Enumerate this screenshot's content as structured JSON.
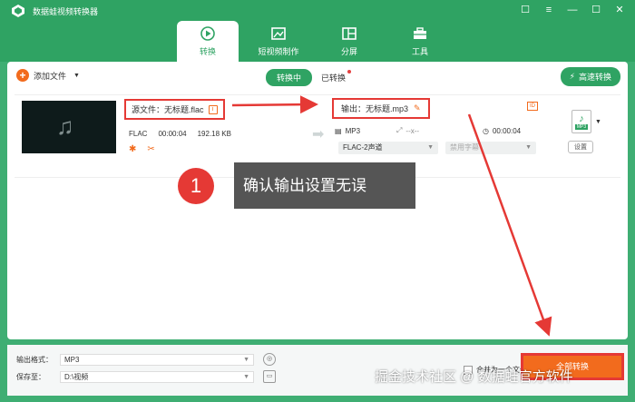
{
  "app": {
    "title": "数据蛙视频转换器"
  },
  "window_controls": [
    "☐",
    "≡",
    "—",
    "☐",
    "✕"
  ],
  "tabs": [
    {
      "label": "转换",
      "icon": "convert-icon",
      "active": true
    },
    {
      "label": "短视频制作",
      "icon": "video-edit-icon",
      "active": false
    },
    {
      "label": "分屏",
      "icon": "split-screen-icon",
      "active": false
    },
    {
      "label": "工具",
      "icon": "toolbox-icon",
      "active": false
    }
  ],
  "toolbar": {
    "add_file": "添加文件",
    "converting": "转换中",
    "converted": "已转换",
    "fast_convert": "高速转换"
  },
  "file": {
    "source_label": "源文件：无标题.flac",
    "src_format": "FLAC",
    "src_duration": "00:00:04",
    "src_size": "192.18 KB",
    "output_label": "输出：无标题.mp3",
    "out_format": "MP3",
    "out_resolution": "--x--",
    "out_duration": "00:00:04",
    "audio_channel": "FLAC-2声道",
    "subtitle": "禁用字幕",
    "format_badge": "MP3",
    "settings": "设置"
  },
  "callout": {
    "number": "1",
    "text": "确认输出设置无误"
  },
  "bottom": {
    "format_label": "输出格式：",
    "format_value": "MP3",
    "save_label": "保存至：",
    "save_value": "D:\\视频",
    "merge_label": "合并为一个文件",
    "convert_all": "全部转换"
  },
  "watermark": "掘金技术社区 @ 数据蛙官方软件",
  "colors": {
    "brand": "#2fa363",
    "accent": "#f26b1d",
    "annotation": "#e53935"
  }
}
